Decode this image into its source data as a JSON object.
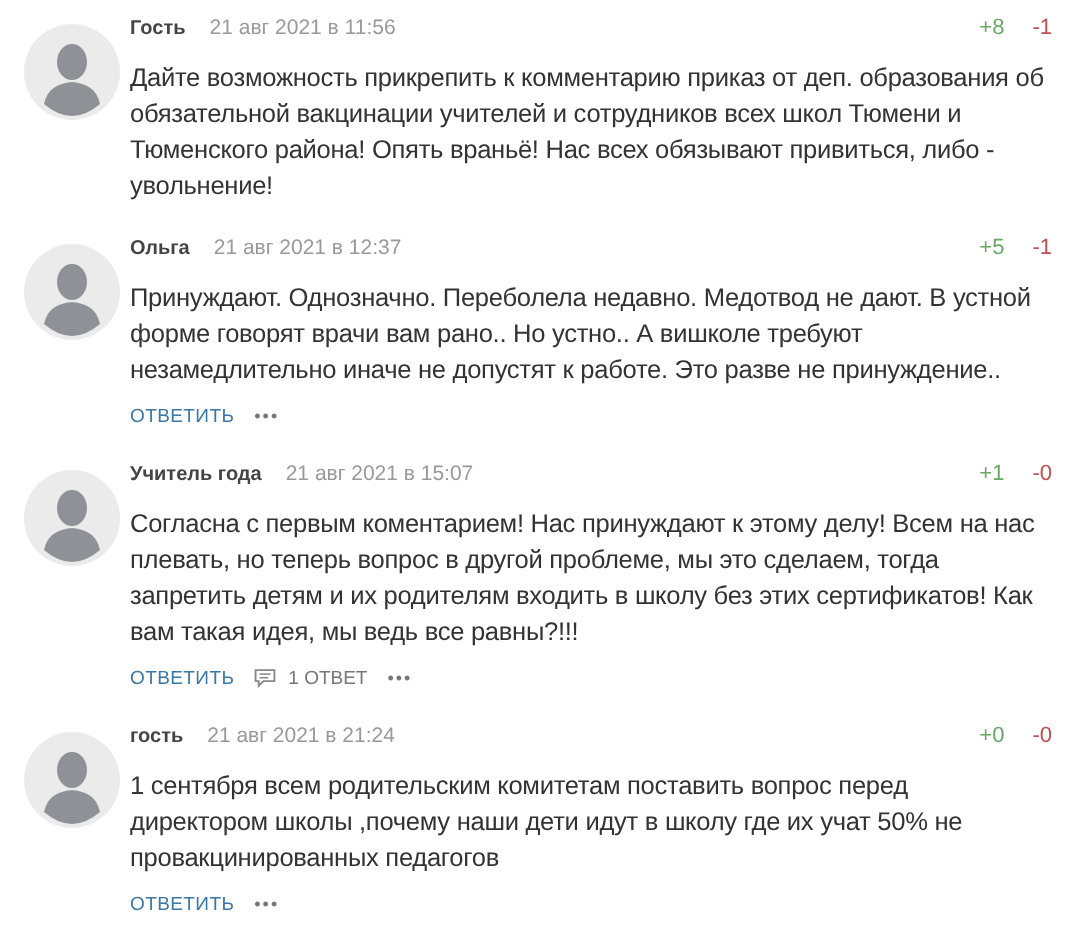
{
  "comments": [
    {
      "author": "Гость",
      "date": "21 авг 2021 в 11:56",
      "likes": "+8",
      "dislikes": "-1",
      "text": "Дайте возможность прикрепить к комментарию приказ от деп. образования об обязательной вакцинации учителей и сотрудников всех школ Тюмени и Тюменского района! Опять враньё! Нас всех обязывают привиться, либо - увольнение!"
    },
    {
      "author": "Ольга",
      "date": "21 авг 2021 в 12:37",
      "likes": "+5",
      "dislikes": "-1",
      "text": "Принуждают. Однозначно. Переболела недавно. Медотвод не дают. В устной форме говорят врачи вам рано.. Но устно.. А вишколе требуют незамедлительно иначе не допустят к работе. Это разве не принуждение..",
      "reply": "ОТВЕТИТЬ",
      "more": "•••"
    },
    {
      "author": "Учитель года",
      "date": "21 авг 2021 в 15:07",
      "likes": "+1",
      "dislikes": "-0",
      "text": "Согласна с первым коментарием! Нас принуждают к этому делу! Всем на нас плевать, но теперь вопрос в другой проблеме, мы это сделаем, тогда запретить детям и их родителям входить в школу без этих сертификатов! Как вам такая идея, мы ведь все равны?!!!",
      "reply": "ОТВЕТИТЬ",
      "replies": "1 ОТВЕТ",
      "more": "•••"
    },
    {
      "author": "гость",
      "date": "21 авг 2021 в 21:24",
      "likes": "+0",
      "dislikes": "-0",
      "text": "1 сентября всем родительским комитетам поставить вопрос перед директором школы ,почему наши дети идут в школу где их учат 50% не провакцинированных педагогов",
      "reply": "ОТВЕТИТЬ",
      "more": "•••"
    }
  ]
}
